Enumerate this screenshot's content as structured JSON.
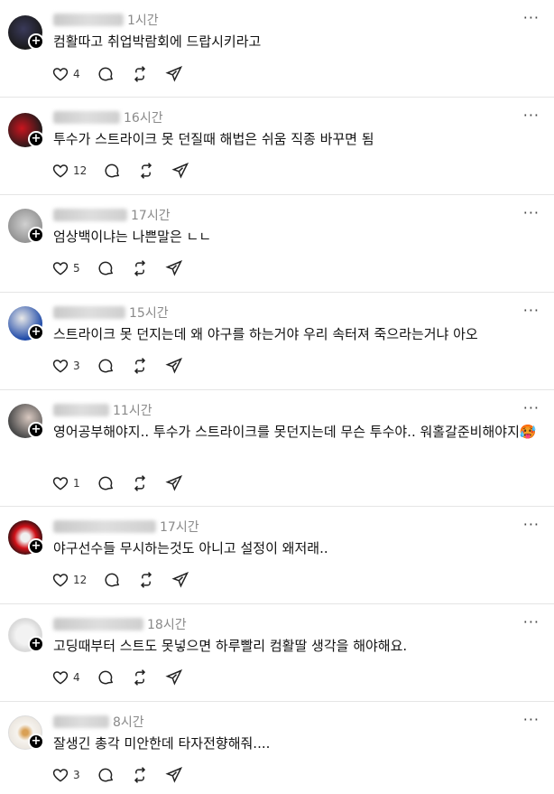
{
  "posts": [
    {
      "time": "1시간",
      "text": "컴활따고 취업박람회에 드랍시키라고",
      "likes": "4",
      "avatar_colors": [
        "#1a1a1a",
        "#3a3a5a"
      ]
    },
    {
      "time": "16시간",
      "text": "투수가 스트라이크 못 던질때 해법은 쉬움 직종 바꾸면 됨",
      "likes": "12",
      "avatar_colors": [
        "#b3121b",
        "#1a1a1a"
      ]
    },
    {
      "time": "17시간",
      "text": "엄상백이냐는 나쁜말은 ㄴㄴ",
      "likes": "5",
      "avatar_colors": [
        "#bfbfbf",
        "#8c8c8c"
      ]
    },
    {
      "time": "15시간",
      "text": "스트라이크 못 던지는데 왜 야구를 하는거야 우리 속터져 죽으라는거냐 아오",
      "likes": "3",
      "avatar_colors": [
        "#1f4aa8",
        "#e8e8e8"
      ]
    },
    {
      "time": "11시간",
      "text": "영어공부해야지.. 투수가 스트라이크를 못던지는데 무슨 투수야.. 워홀갈준비해야지🥵",
      "likes": "1",
      "avatar_colors": [
        "#4a4a4a",
        "#d8c8c0"
      ]
    },
    {
      "time": "17시간",
      "text": "야구선수들 무시하는것도 아니고 설정이 왜저래..",
      "likes": "12",
      "avatar_colors": [
        "#d01018",
        "#111111"
      ]
    },
    {
      "time": "18시간",
      "text": "고딩때부터 스트도 못넣으면 하루빨리 컴활딸 생각을 해야해요.",
      "likes": "4",
      "avatar_colors": [
        "#f2f2f2",
        "#c8c8c8"
      ]
    },
    {
      "time": "8시간",
      "text": "잘생긴 총각 미안한데 타자전향해줘....",
      "likes": "3",
      "avatar_colors": [
        "#f6f3ee",
        "#d9a055"
      ]
    }
  ],
  "icons": {
    "like": "heart-icon",
    "reply": "comment-icon",
    "repost": "repost-icon",
    "share": "send-icon",
    "more": "more-icon",
    "follow": "plus-icon"
  },
  "more_glyph": "···",
  "follow_glyph": "+"
}
